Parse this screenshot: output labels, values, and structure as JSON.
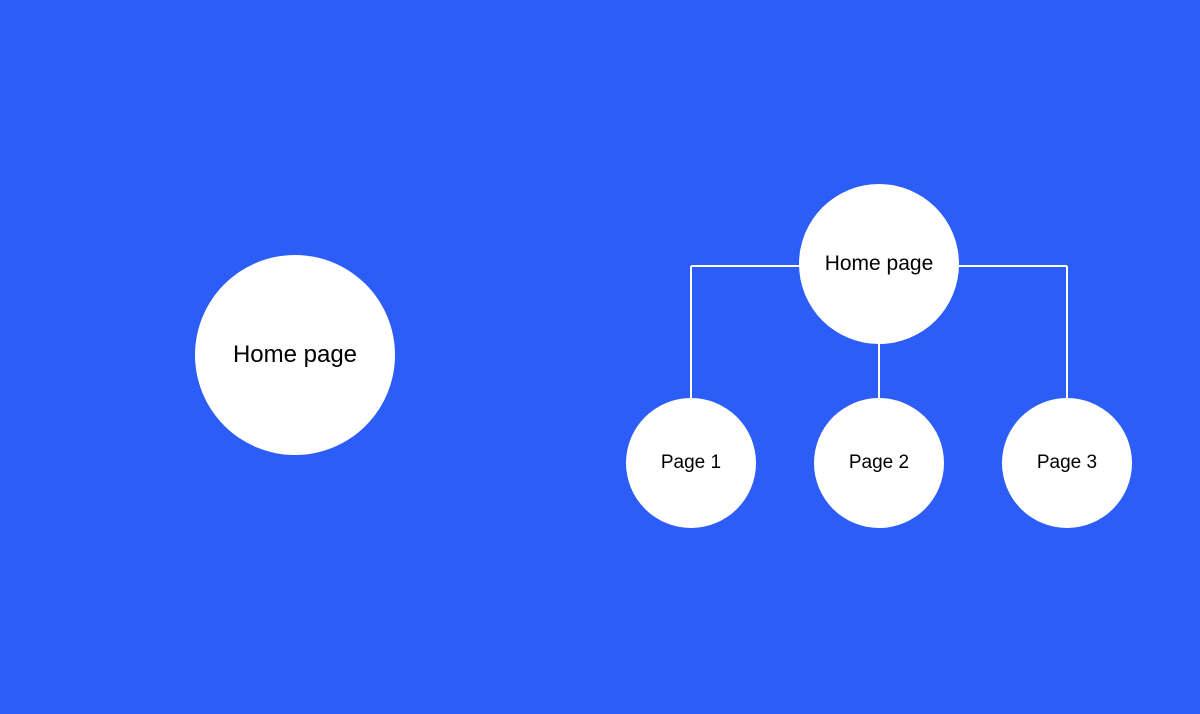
{
  "diagram": {
    "left": {
      "root": "Home page"
    },
    "right": {
      "root": "Home page",
      "children": [
        "Page 1",
        "Page 2",
        "Page 3"
      ]
    }
  },
  "colors": {
    "background": "#2C5EF7",
    "node": "#FFFFFF",
    "text": "#000000",
    "line": "#FFFFFF"
  }
}
